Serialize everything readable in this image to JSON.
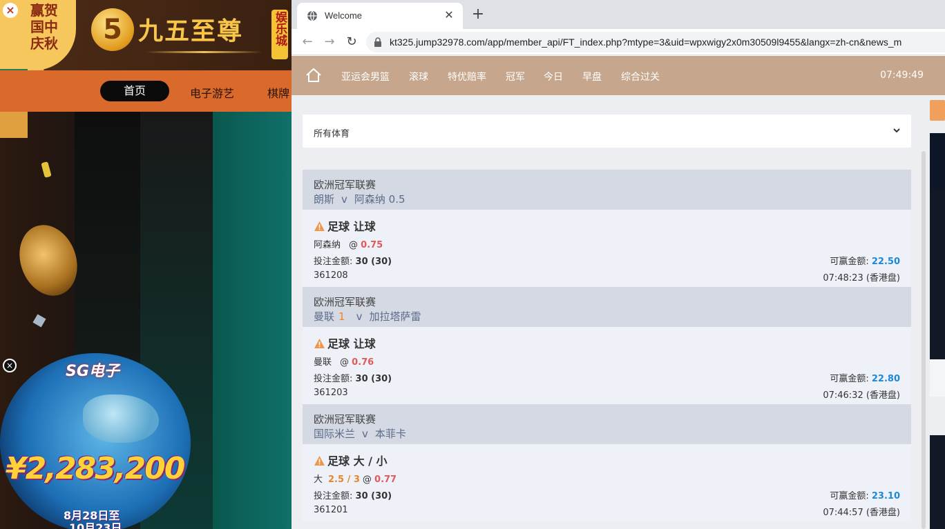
{
  "background_site": {
    "festival_text": [
      "赢贺",
      "国中",
      "庆秋"
    ],
    "logo_number": "5",
    "logo_name": "九五至尊",
    "logo_tag": "娱乐城",
    "nav": [
      "首页",
      "电子游艺",
      "棋牌"
    ],
    "promo": {
      "brand": "SG电子",
      "amount": "¥2,283,200",
      "date1": "8月28日至",
      "date2": "10月23日"
    }
  },
  "browser": {
    "tab_title": "Welcome",
    "url": "kt325.jump32978.com/app/member_api/FT_index.php?mtype=3&uid=wpxwigy2x0m30509l9455&langx=zh-cn&news_m"
  },
  "topnav": {
    "items": [
      "亚运会男篮",
      "滚球",
      "特优赔率",
      "冠军",
      "今日",
      "早盘",
      "综合过关"
    ],
    "clock": "07:49:49"
  },
  "filter": {
    "label": "所有体育"
  },
  "bets": [
    {
      "league": "欧洲冠军联赛",
      "home": "朗斯",
      "score": "",
      "vs": "v",
      "away": "阿森纳 0.5",
      "type": "足球 让球",
      "selection": "阿森纳",
      "line": "",
      "at": "@",
      "odds": "0.75",
      "stake_label": "投注金额:",
      "stake": "30 (30)",
      "win_label": "可赢金额:",
      "win": "22.50",
      "ticket": "361208",
      "time": "07:48:23 (香港盘)"
    },
    {
      "league": "欧洲冠军联赛",
      "home": "曼联",
      "score": "1",
      "vs": "v",
      "away": "加拉塔萨雷",
      "type": "足球 让球",
      "selection": "曼联",
      "line": "",
      "at": "@",
      "odds": "0.76",
      "stake_label": "投注金额:",
      "stake": "30 (30)",
      "win_label": "可赢金额:",
      "win": "22.80",
      "ticket": "361203",
      "time": "07:46:32 (香港盘)"
    },
    {
      "league": "欧洲冠军联赛",
      "home": "国际米兰",
      "score": "",
      "vs": "v",
      "away": "本菲卡",
      "type": "足球 大 / 小",
      "selection": "大",
      "line": "2.5 / 3",
      "at": "@",
      "odds": "0.77",
      "stake_label": "投注金额:",
      "stake": "30 (30)",
      "win_label": "可赢金额:",
      "win": "23.10",
      "ticket": "361201",
      "time": "07:44:57 (香港盘)"
    }
  ],
  "colors": {
    "topnav_bg": "#c6a68c",
    "odds": "#e05a5a",
    "win": "#1e88d8",
    "line": "#e8852a",
    "league_bg": "#d5d9e4"
  },
  "icons": [
    "home-icon",
    "warning-icon",
    "chevron-down-icon",
    "lock-icon",
    "globe-icon",
    "close-icon",
    "plus-icon",
    "back-arrow-icon",
    "forward-arrow-icon",
    "reload-icon"
  ]
}
